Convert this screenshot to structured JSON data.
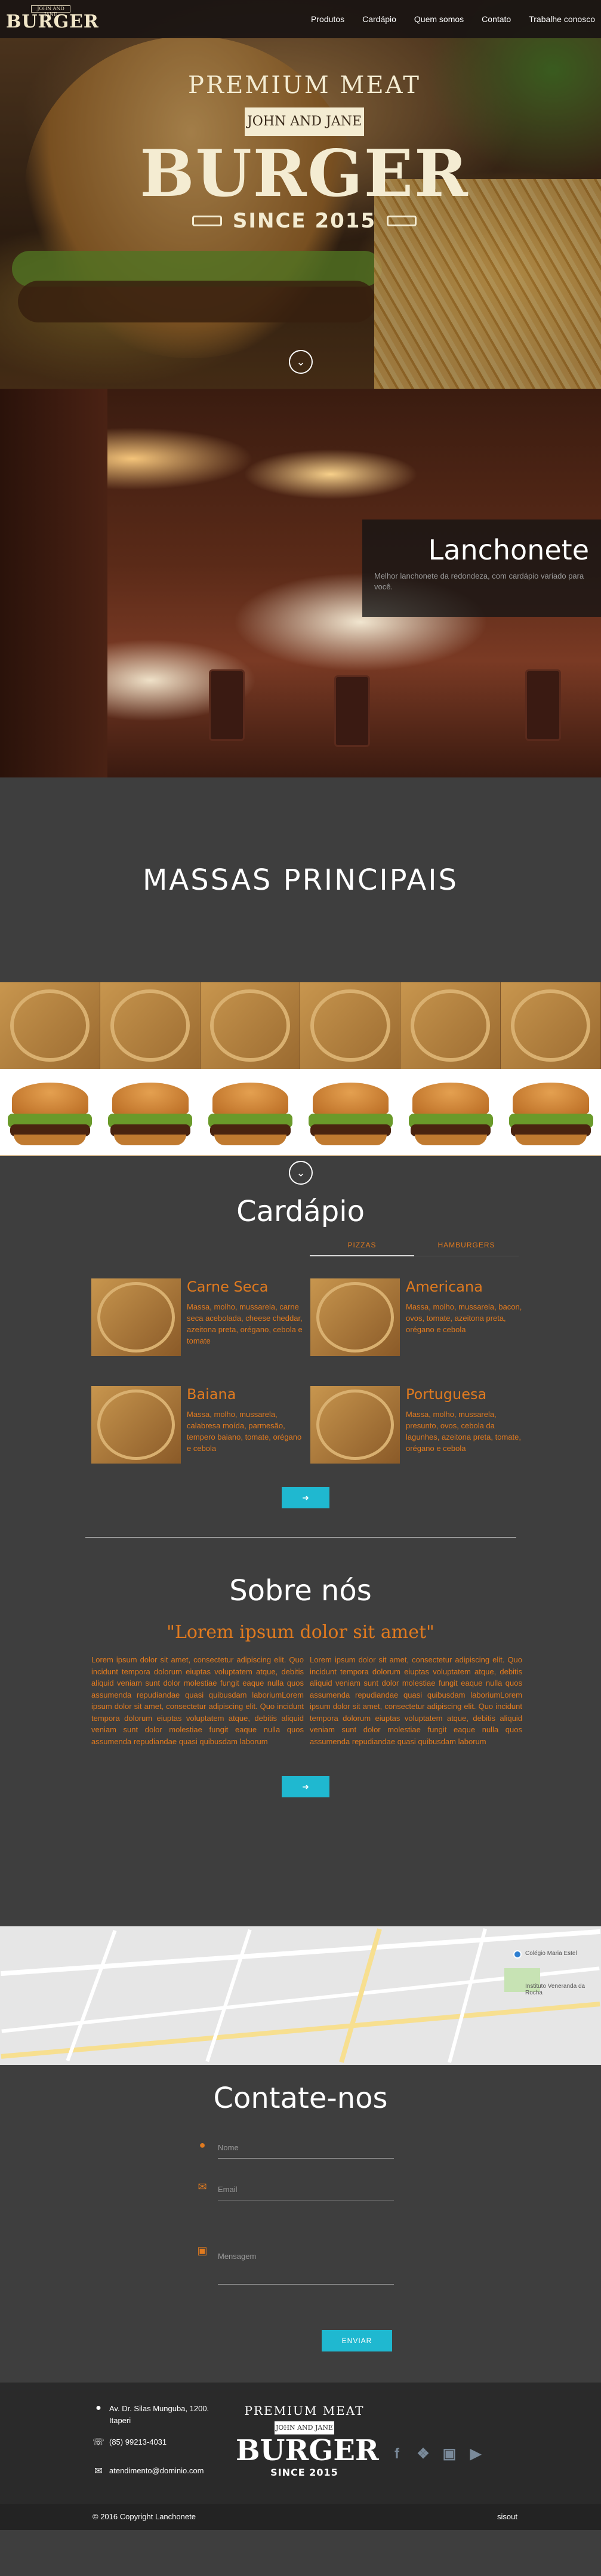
{
  "nav": {
    "logo_top": "JOHN AND JANE",
    "logo_main": "BURGER",
    "links": [
      "Produtos",
      "Cardápio",
      "Quem somos",
      "Contato",
      "Trabalhe conosco"
    ]
  },
  "hero": {
    "premium": "PREMIUM MEAT",
    "ribbon": "JOHN AND JANE",
    "burger": "BURGER",
    "since": "SINCE 2015",
    "scroll_icon": "chevron-down-icon"
  },
  "resto": {
    "title": "Lanchonete",
    "text": "Melhor lanchonete da redondeza, com cardápio variado para você."
  },
  "massas": {
    "title": "MASSAS PRINCIPAIS"
  },
  "cardapio": {
    "title": "Cardápio",
    "tabs": [
      "PIZZAS",
      "HAMBURGERS"
    ],
    "items": [
      {
        "name": "Carne Seca",
        "desc": "Massa, molho, mussarela, carne seca acebolada, cheese cheddar, azeitona preta, orégano, cebola e tomate"
      },
      {
        "name": "Americana",
        "desc": "Massa, molho, mussarela, bacon, ovos, tomate, azeitona preta, orégano e cebola"
      },
      {
        "name": "Baiana",
        "desc": "Massa, molho, mussarela, calabresa moída, parmesão, tempero baiano, tomate, orégano e cebola"
      },
      {
        "name": "Portuguesa",
        "desc": "Massa, molho, mussarela, presunto, ovos, cebola da lagunhes, azeitona preta, tomate, orégano e cebola"
      }
    ],
    "button_icon": "arrow-right-icon"
  },
  "sobre": {
    "title": "Sobre nós",
    "quote": "\"Lorem ipsum dolor sit amet\"",
    "col1": "Lorem ipsum dolor sit amet, consectetur adipiscing elit. Quo incidunt tempora dolorum eiuptas voluptatem atque, debitis aliquid veniam sunt dolor molestiae fungit eaque nulla quos assumenda repudiandae quasi quibusdam laboriumLorem ipsum dolor sit amet, consectetur adipiscing elit. Quo incidunt tempora dolorum eiuptas voluptatem atque, debitis aliquid veniam sunt dolor molestiae fungit eaque nulla quos assumenda repudiandae quasi quibusdam laborum",
    "col2": "Lorem ipsum dolor sit amet, consectetur adipiscing elit. Quo incidunt tempora dolorum eiuptas voluptatem atque, debitis aliquid veniam sunt dolor molestiae fungit eaque nulla quos assumenda repudiandae quasi quibusdam laboriumLorem ipsum dolor sit amet, consectetur adipiscing elit. Quo incidunt tempora dolorum eiuptas voluptatem atque, debitis aliquid veniam sunt dolor molestiae fungit eaque nulla quos assumenda repudiandae quasi quibusdam laborum",
    "button_icon": "arrow-right-icon"
  },
  "map": {
    "labels": [
      "Colégio Maria Estel",
      "Instituto Veneranda da Rocha"
    ]
  },
  "contato": {
    "title": "Contate-nos",
    "name_placeholder": "Nome",
    "email_placeholder": "Email",
    "message_placeholder": "Mensagem",
    "submit": "ENVIAR"
  },
  "footer": {
    "address_line1": "Av. Dr. Silas Munguba, 1200.",
    "address_line2": "Itaperi",
    "phone": "(85) 99213-4031",
    "email": "atendimento@dominio.com",
    "logo": {
      "premium": "PREMIUM MEAT",
      "ribbon": "JOHN AND JANE",
      "burger": "BURGER",
      "since": "SINCE 2015"
    },
    "copyright": "© 2016 Copyright Lanchonete",
    "credit": "sisout",
    "social_icons": [
      "facebook-icon",
      "twitter-icon",
      "instagram-icon",
      "youtube-icon"
    ]
  }
}
